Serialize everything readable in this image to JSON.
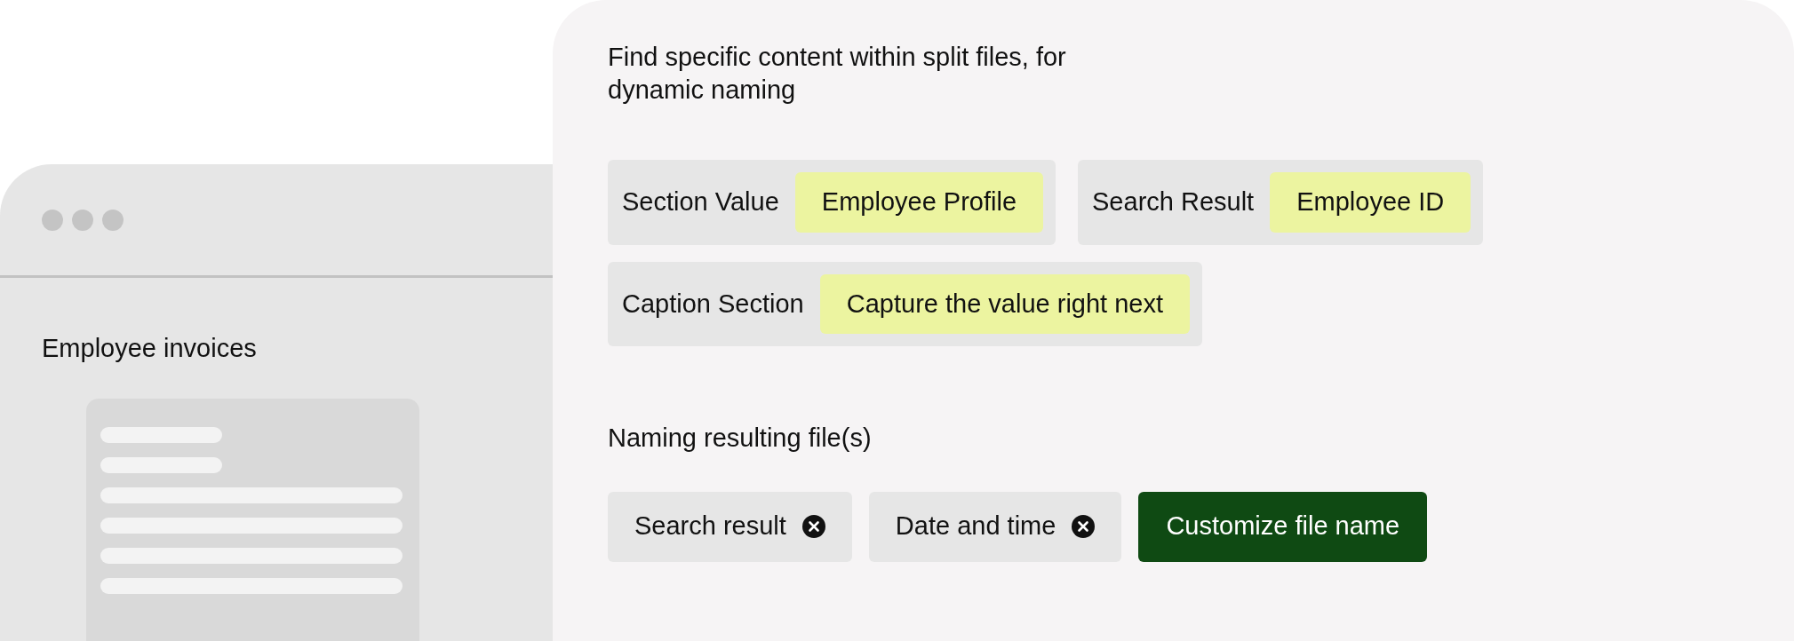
{
  "back_window": {
    "title": "Employee invoices"
  },
  "panel": {
    "heading": "Find specific content within split files, for dynamic naming",
    "fields": [
      {
        "label": "Section Value",
        "value": "Employee Profile"
      },
      {
        "label": "Search Result",
        "value": "Employee ID"
      },
      {
        "label": "Caption Section",
        "value": "Capture the value right next"
      }
    ],
    "naming_title": "Naming resulting file(s)",
    "tags": [
      {
        "label": "Search result"
      },
      {
        "label": "Date and time"
      }
    ],
    "button": "Customize file name"
  }
}
